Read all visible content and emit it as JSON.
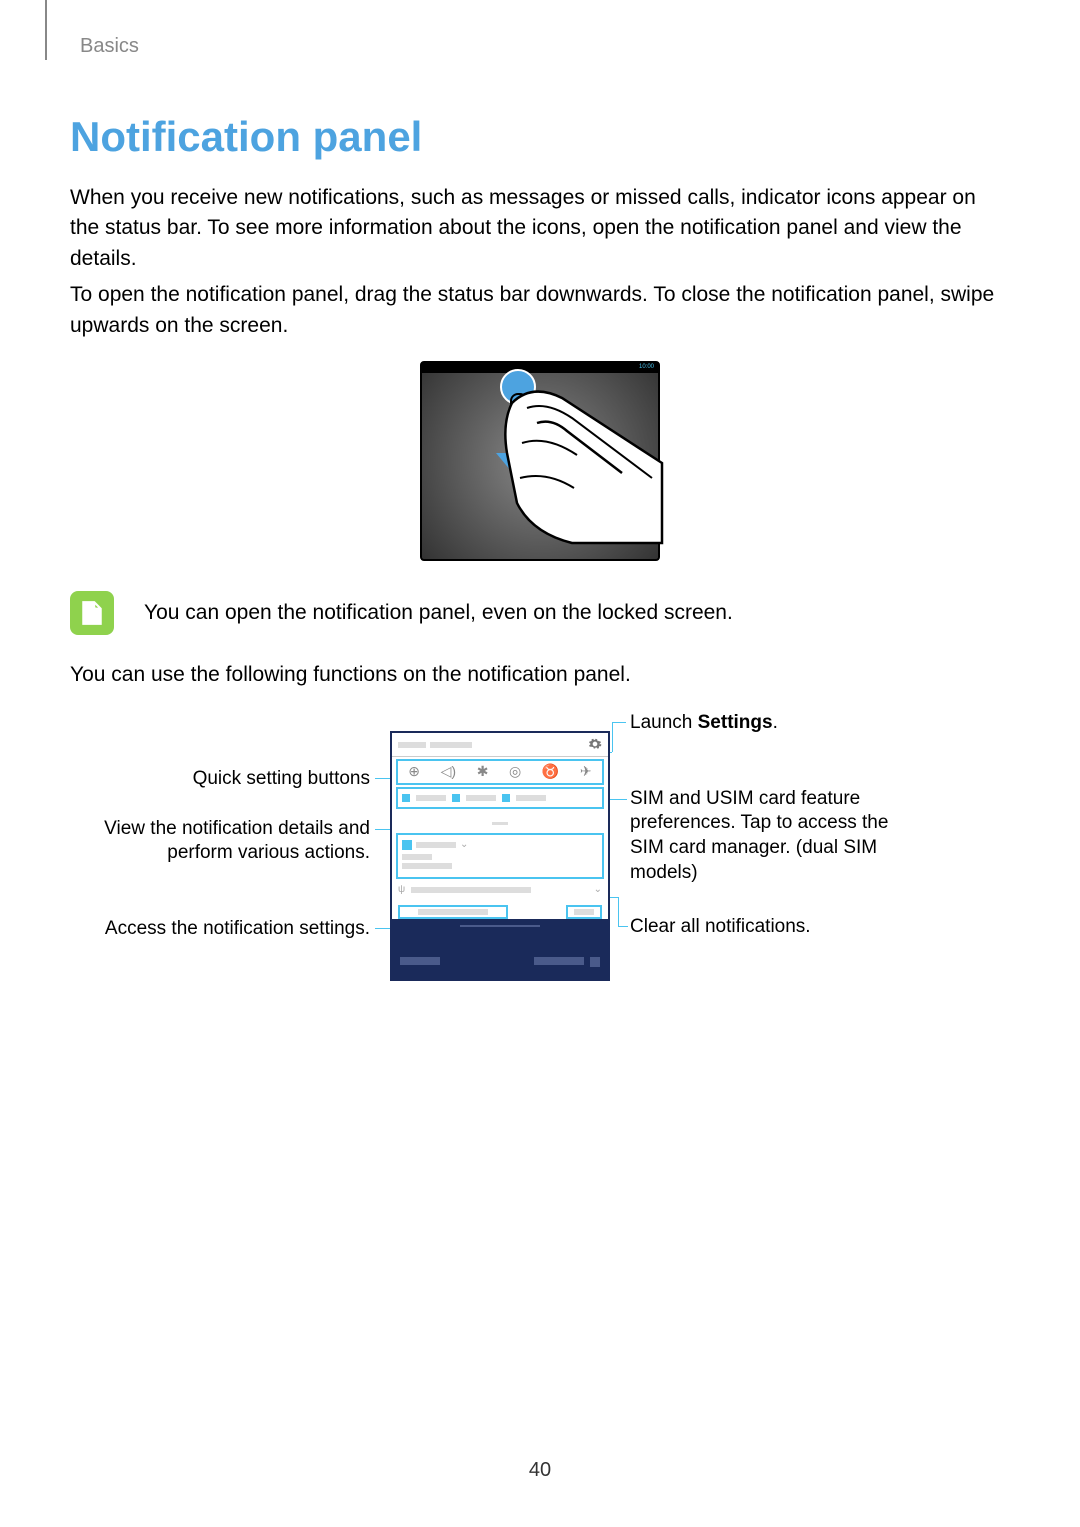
{
  "breadcrumb": "Basics",
  "title": "Notification panel",
  "para1": "When you receive new notifications, such as messages or missed calls, indicator icons appear on the status bar. To see more information about the icons, open the notification panel and view the details.",
  "para2": "To open the notification panel, drag the status bar downwards. To close the notification panel, swipe upwards on the screen.",
  "illustration1_status_time": "10:00",
  "note_text": "You can open the notification panel, even on the locked screen.",
  "para3": "You can use the following functions on the notification panel.",
  "callouts": {
    "left_quick": "Quick setting buttons",
    "left_view_1": "View the notification details and",
    "left_view_2": "perform various actions.",
    "left_access": "Access the notification settings.",
    "right_launch_pre": "Launch ",
    "right_launch_strong": "Settings",
    "right_launch_post": ".",
    "right_sim_1": "SIM and USIM card feature",
    "right_sim_2": "preferences. Tap to access the",
    "right_sim_3": "SIM card manager. (dual SIM",
    "right_sim_4": "models)",
    "right_clear": "Clear all notifications."
  },
  "page_number": "40"
}
